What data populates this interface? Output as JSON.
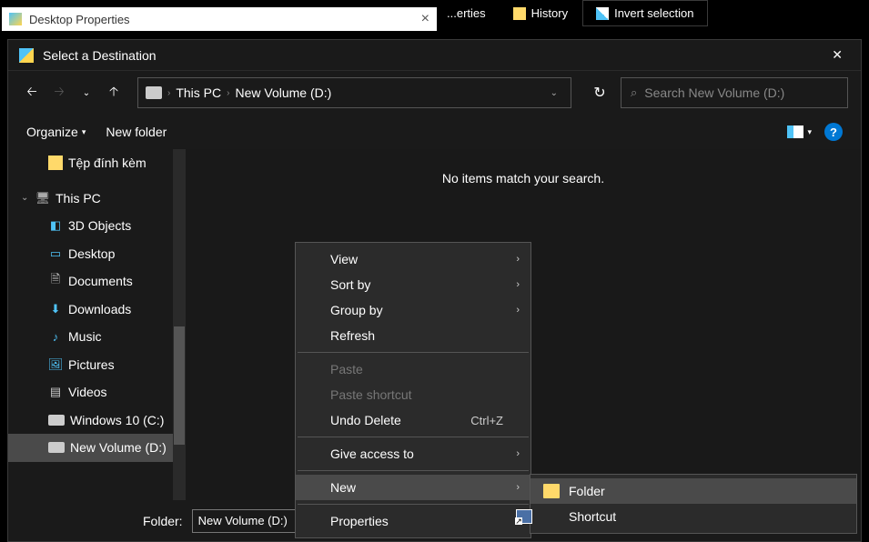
{
  "bgWindow": {
    "title": "Desktop Properties"
  },
  "ribbon": {
    "properties": "...erties",
    "history": "History",
    "invert": "Invert selection"
  },
  "dialog": {
    "title": "Select a Destination"
  },
  "address": {
    "seg1": "This PC",
    "seg2": "New Volume (D:)"
  },
  "search": {
    "placeholder": "Search New Volume (D:)"
  },
  "toolbar": {
    "organize": "Organize",
    "newFolder": "New folder"
  },
  "tree": {
    "attach": "Tệp đính kèm",
    "thisPc": "This PC",
    "objects3d": "3D Objects",
    "desktop": "Desktop",
    "documents": "Documents",
    "downloads": "Downloads",
    "music": "Music",
    "pictures": "Pictures",
    "videos": "Videos",
    "cdrive": "Windows 10 (C:)",
    "ddrive": "New Volume (D:)"
  },
  "content": {
    "empty": "No items match your search."
  },
  "footer": {
    "label": "Folder:",
    "value": "New Volume (D:)"
  },
  "contextMenu": {
    "view": "View",
    "sortBy": "Sort by",
    "groupBy": "Group by",
    "refresh": "Refresh",
    "paste": "Paste",
    "pasteShortcut": "Paste shortcut",
    "undoDelete": "Undo Delete",
    "undoShortcut": "Ctrl+Z",
    "giveAccess": "Give access to",
    "new": "New",
    "properties": "Properties"
  },
  "submenu": {
    "folder": "Folder",
    "shortcut": "Shortcut"
  }
}
